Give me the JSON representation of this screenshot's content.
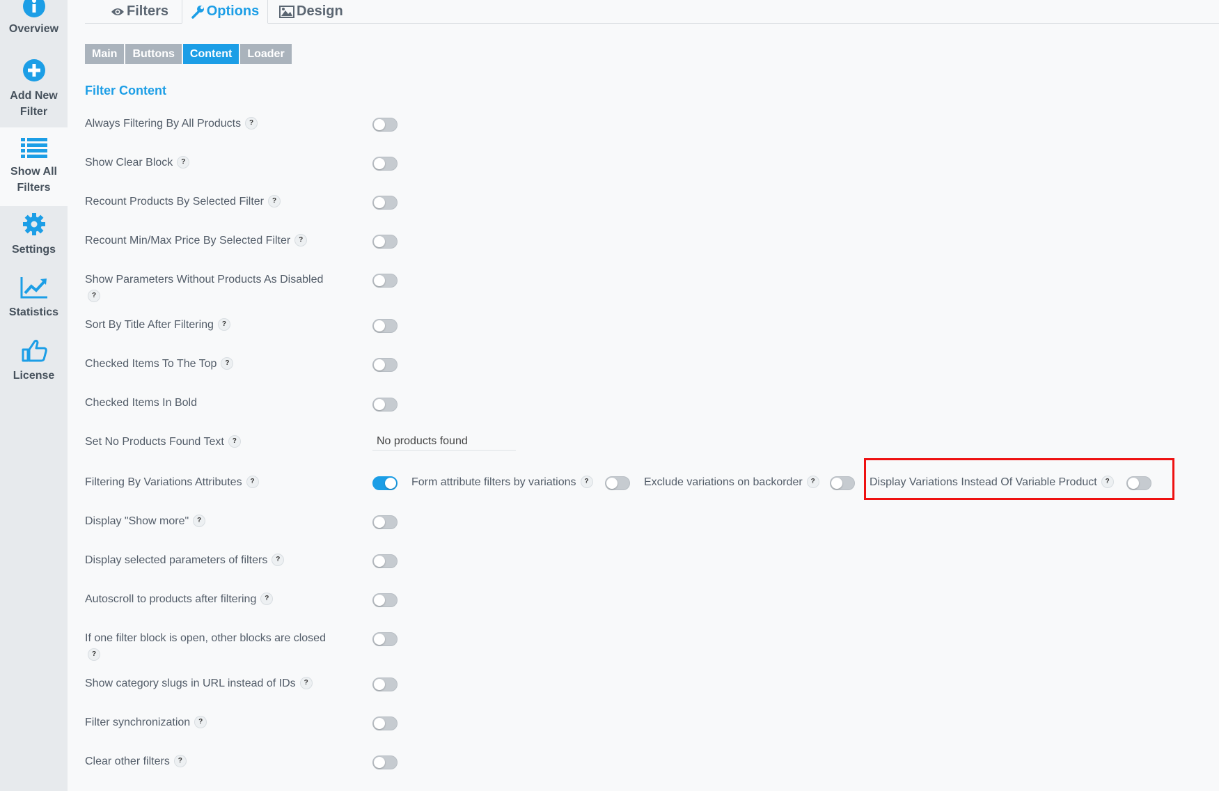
{
  "sidebar": {
    "items": [
      {
        "label_lines": [
          "Overview"
        ],
        "icon": "info-icon"
      },
      {
        "label_lines": [
          "Add New",
          "Filter"
        ],
        "icon": "plus-circle-icon"
      },
      {
        "label_lines": [
          "Show All",
          "Filters"
        ],
        "icon": "list-icon"
      },
      {
        "label_lines": [
          "Settings"
        ],
        "icon": "gear-icon"
      },
      {
        "label_lines": [
          "Statistics"
        ],
        "icon": "chart-line-icon"
      },
      {
        "label_lines": [
          "License"
        ],
        "icon": "thumbs-up-icon"
      }
    ],
    "active": "Show All Filters"
  },
  "top_tabs": [
    {
      "label": "Filters",
      "icon": "eye-icon"
    },
    {
      "label": "Options",
      "icon": "wrench-icon",
      "active": true
    },
    {
      "label": "Design",
      "icon": "image-icon"
    }
  ],
  "sub_tabs": [
    {
      "label": "Main"
    },
    {
      "label": "Buttons"
    },
    {
      "label": "Content",
      "active": true
    },
    {
      "label": "Loader"
    }
  ],
  "section": {
    "title": "Filter Content"
  },
  "help_glyph": "?",
  "rows": [
    {
      "label": "Always Filtering By All Products",
      "on": false
    },
    {
      "label": "Show Clear Block",
      "on": false
    },
    {
      "label": "Recount Products By Selected Filter",
      "on": false
    },
    {
      "label": "Recount Min/Max Price By Selected Filter",
      "on": false
    },
    {
      "label": "Show Parameters Without Products As Disabled",
      "on": false
    },
    {
      "label": "Sort By Title After Filtering",
      "on": false
    },
    {
      "label": "Checked Items To The Top",
      "on": false
    },
    {
      "label": "Checked Items In Bold",
      "on": false
    },
    {
      "label": "Set No Products Found Text",
      "value": "No products found"
    },
    {
      "label": "Filtering By Variations Attributes",
      "on": true
    },
    {
      "label": "Display \"Show more\"",
      "on": false
    },
    {
      "label": "Display selected parameters of filters",
      "on": false
    },
    {
      "label": "Autoscroll to products after filtering",
      "on": false
    },
    {
      "label": "If one filter block is open, other blocks are closed",
      "on": false
    },
    {
      "label": "Show category slugs in URL instead of IDs",
      "on": false
    },
    {
      "label": "Filter synchronization",
      "on": false
    },
    {
      "label": "Clear other filters",
      "on": false
    }
  ],
  "variation_options": [
    {
      "label": "Form attribute filters by variations",
      "on": false
    },
    {
      "label": "Exclude variations on backorder",
      "on": false
    },
    {
      "label": "Display Variations Instead Of Variable Product",
      "on": false
    }
  ],
  "colors": {
    "accent": "#1c9ee6",
    "highlight": "#ee1111",
    "sidebar_bg": "#e7eaed",
    "page_bg": "#f8f9fa"
  }
}
